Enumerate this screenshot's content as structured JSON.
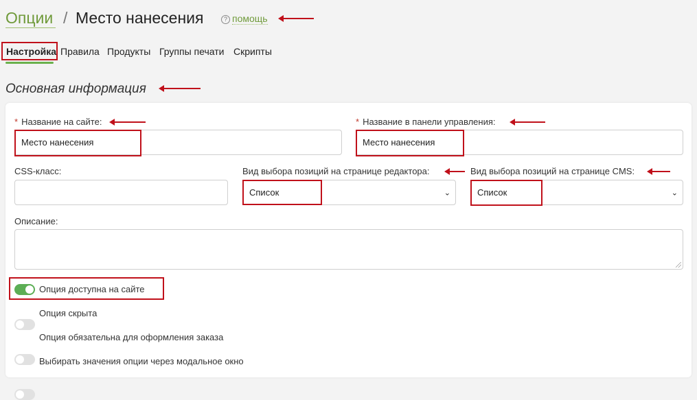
{
  "header": {
    "breadcrumb_root": "Опции",
    "breadcrumb_separator": "/",
    "breadcrumb_current": "Место нанесения",
    "help_label": "помощь",
    "help_icon": "?"
  },
  "tabs": [
    {
      "label": "Настройка",
      "active": true
    },
    {
      "label": "Правила"
    },
    {
      "label": "Продукты"
    },
    {
      "label": "Группы печати"
    },
    {
      "label": "Скрипты"
    }
  ],
  "section": {
    "title": "Основная информация"
  },
  "form": {
    "required_mark": "*",
    "site_name": {
      "label": "Название на сайте:",
      "value": "Место нанесения"
    },
    "panel_name": {
      "label": "Название в панели управления:",
      "value": "Место нанесения"
    },
    "css_class": {
      "label": "CSS-класс:",
      "value": ""
    },
    "editor_select": {
      "label": "Вид выбора позиций на странице редактора:",
      "value": "Список"
    },
    "cms_select": {
      "label": "Вид выбора позиций на странице CMS:",
      "value": "Список"
    },
    "description": {
      "label": "Описание:",
      "value": ""
    },
    "select_arrow": "⌄"
  },
  "toggles": [
    {
      "label": "Опция доступна на сайте",
      "on": true
    },
    {
      "label": "Опция скрыта",
      "on": false
    },
    {
      "label": "Опция обязательна для оформления заказа",
      "on": false
    },
    {
      "label": "Выбирать значения опции через модальное окно",
      "on": false
    }
  ],
  "colors": {
    "accent_green": "#6f9a3a",
    "toggle_on": "#5cae55",
    "annotation_red": "#c0101a"
  }
}
